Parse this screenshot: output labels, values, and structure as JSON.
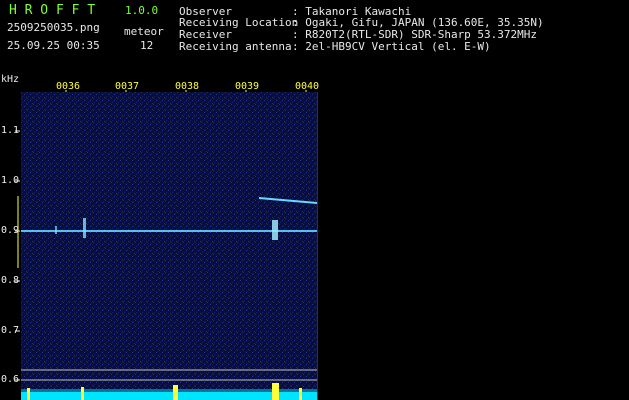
{
  "app": {
    "name": "H R O F F T",
    "version": "1.0.0"
  },
  "file": {
    "name": "2509250035.png",
    "timestamp": "25.09.25 00:35",
    "meteor_label": "meteor",
    "meteor_count": "12"
  },
  "info": [
    {
      "label": "Observer",
      "value": ": Takanori Kawachi"
    },
    {
      "label": "Receiving Location",
      "value": ": Ogaki, Gifu, JAPAN (136.60E, 35.35N)"
    },
    {
      "label": "Receiver",
      "value": ": R820T2(RTL-SDR) SDR-Sharp 53.372MHz"
    },
    {
      "label": "Receiving antenna",
      "value": ": 2el-HB9CV Vertical (el. E-W)"
    }
  ],
  "spectrogram": {
    "y_unit": "kHz",
    "y_ticks": [
      "1.1",
      "1.0",
      "0.9",
      "0.8",
      "0.7",
      "0.6"
    ],
    "time_ticks": [
      "0036",
      "0037",
      "0038",
      "0039",
      "0040"
    ],
    "colors": {
      "background": "#0a0f3a",
      "carrier": "#5fd4ff",
      "bars": "#00e5ff",
      "accent": "#ffff3a"
    }
  }
}
